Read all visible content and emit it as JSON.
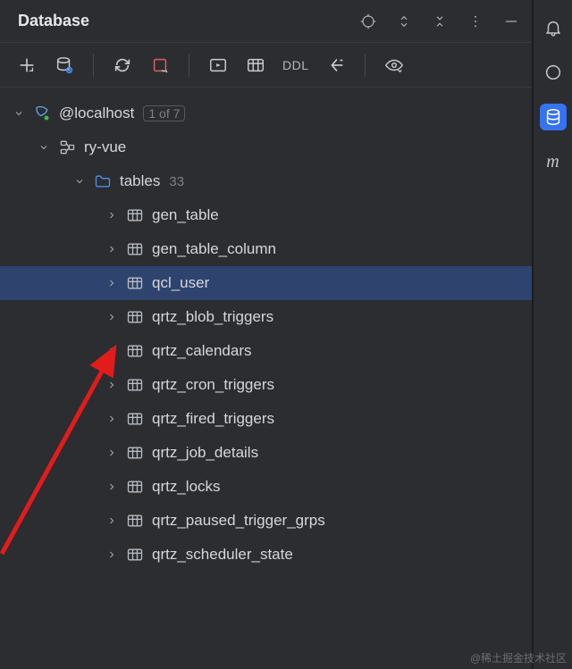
{
  "panel_title": "Database",
  "toolbar": {
    "ddl_label": "DDL"
  },
  "root": {
    "label": "@localhost",
    "counter": "1 of 7",
    "db": {
      "label": "ry-vue",
      "folder": {
        "label": "tables",
        "count": "33",
        "tables": [
          "gen_table",
          "gen_table_column",
          "qcl_user",
          "qrtz_blob_triggers",
          "qrtz_calendars",
          "qrtz_cron_triggers",
          "qrtz_fired_triggers",
          "qrtz_job_details",
          "qrtz_locks",
          "qrtz_paused_trigger_grps",
          "qrtz_scheduler_state"
        ],
        "selected_index": 2
      }
    }
  },
  "right_strip_text_icon": "m",
  "watermark": "@稀土掘金技术社区"
}
